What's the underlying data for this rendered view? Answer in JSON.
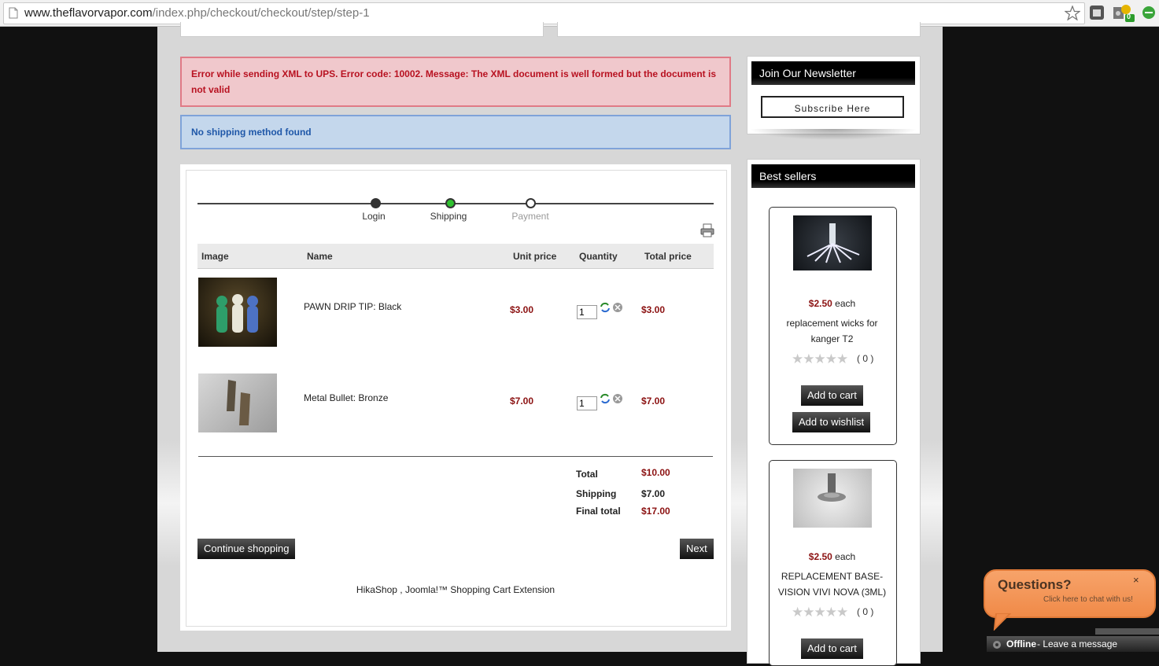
{
  "browser": {
    "url_host": "www.theflavorvapor.com",
    "url_path": "/index.php/checkout/checkout/step/step-1",
    "icons": [
      "page-icon",
      "star-icon",
      "extension-icon",
      "evernote-icon",
      "badge-icon",
      "green-circle-icon"
    ],
    "extension_badge": "0"
  },
  "messages": {
    "error": "Error while sending XML to UPS. Error code: 10002. Message: The XML document is well formed but the document is not valid",
    "info": "No shipping method found"
  },
  "steps": [
    {
      "label": "Login",
      "state": "done"
    },
    {
      "label": "Shipping",
      "state": "current"
    },
    {
      "label": "Payment",
      "state": "todo"
    }
  ],
  "cart": {
    "headers": {
      "image": "Image",
      "name": "Name",
      "unit_price": "Unit price",
      "quantity": "Quantity",
      "total_price": "Total price"
    },
    "rows": [
      {
        "name": "PAWN DRIP TIP: Black",
        "unit_price": "$3.00",
        "quantity": "1",
        "total": "$3.00"
      },
      {
        "name": "Metal Bullet: Bronze",
        "unit_price": "$7.00",
        "quantity": "1",
        "total": "$7.00"
      }
    ],
    "totals": {
      "total_label": "Total",
      "total_value": "$10.00",
      "shipping_label": "Shipping",
      "shipping_value": "$7.00",
      "final_label": "Final total",
      "final_value": "$17.00"
    },
    "continue_label": "Continue shopping",
    "next_label": "Next",
    "footer": "HikaShop , Joomla!™ Shopping Cart Extension"
  },
  "newsletter": {
    "title": "Join Our Newsletter",
    "button": "Subscribe Here"
  },
  "bestsellers": {
    "title": "Best sellers",
    "items": [
      {
        "price": "$2.50",
        "each": "each",
        "name": "replacement wicks for kanger T2",
        "rating": "( 0 )",
        "add_cart": "Add to cart",
        "add_wishlist": "Add to wishlist"
      },
      {
        "price": "$2.50",
        "each": "each",
        "name": "REPLACEMENT BASE- VISION VIVI NOVA (3ML)",
        "rating": "( 0 )",
        "add_cart": "Add to cart"
      }
    ]
  },
  "chat": {
    "title": "Questions?",
    "subtitle": "Click here to chat with us!",
    "close": "×",
    "status": "Offline",
    "status_suffix": " - Leave a message"
  },
  "colors": {
    "price": "#8b1111",
    "error_bg": "#f0c8cc",
    "info_bg": "#c4d7ec",
    "chat_orange": "#f08a48"
  }
}
